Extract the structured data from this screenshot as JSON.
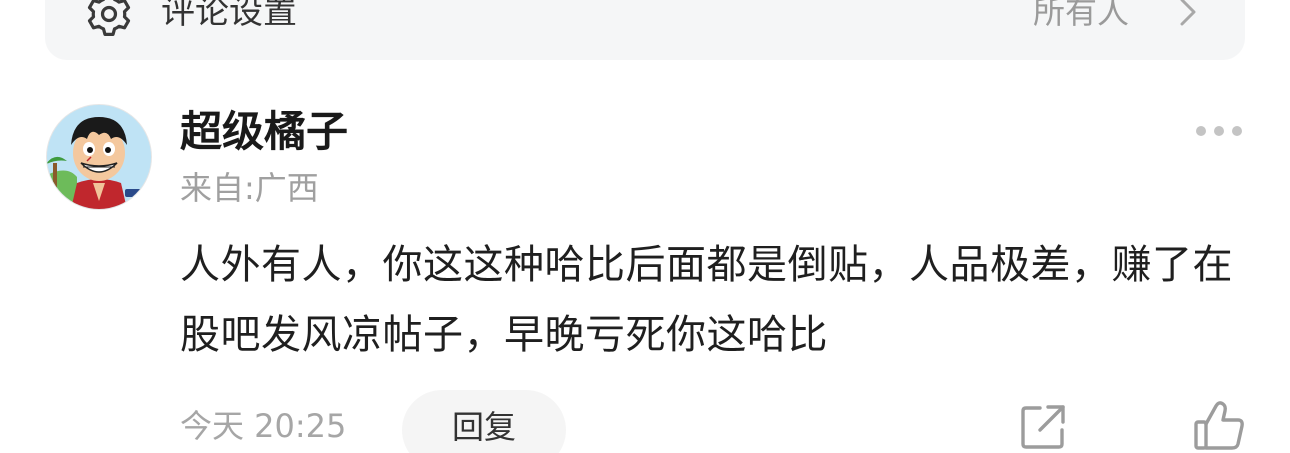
{
  "settings": {
    "label": "评论设置",
    "value": "所有人",
    "icon": "gear-icon",
    "chevron_icon": "chevron-right-icon"
  },
  "comment": {
    "username": "超级橘子",
    "location": "来自:广西",
    "text": "人外有人，你这这种哈比后面都是倒贴，人品极差，赚了在股吧发风凉帖子，早晚亏死你这哈比",
    "timestamp": "今天 20:25",
    "reply_label": "回复",
    "more_icon": "more-dots-icon",
    "share_icon": "share-icon",
    "like_icon": "thumbs-up-icon"
  },
  "colors": {
    "settings_bg": "#f5f6f7",
    "secondary_text": "#a0a0a0",
    "primary_text": "#1f1f1f",
    "icon_gray": "#b0b0b0"
  }
}
